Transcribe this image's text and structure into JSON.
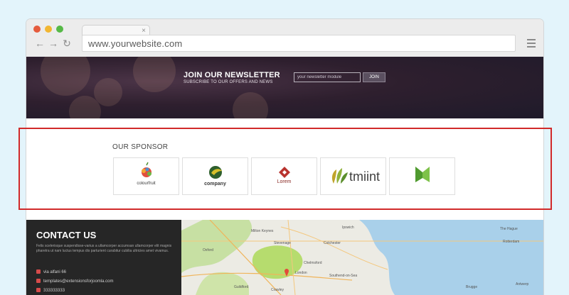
{
  "browser": {
    "url": "www.yourwebsite.com",
    "tab_close": "×"
  },
  "newsletter": {
    "title": "JOIN OUR NEWSLETTER",
    "subtitle": "SUBSCRIBE TO OUR OFFERS AND NEWS",
    "input_placeholder": "your newsletter module",
    "button_label": "JOIN"
  },
  "sponsors": {
    "title": "OUR SPONSOR",
    "items": [
      {
        "name": "colourfruit"
      },
      {
        "name": "company"
      },
      {
        "name": "Lorem"
      },
      {
        "name": "tmiint"
      },
      {
        "name": ""
      }
    ]
  },
  "contact": {
    "title": "CONTACT US",
    "description": "Felis scelerisque suspendisse-varius a ullamcorper accumsan ullamcorper elit magnis pharetra ut nam luctus tempus dis parturient curabitur cubilia ultricies amet vivamus.",
    "address": "via alfani 66",
    "email": "templates@extensionsforjoomla.com",
    "phone": "333333333"
  },
  "map": {
    "labels": [
      "Ipswich",
      "Milton Keynes",
      "Stevenage",
      "Colchester",
      "Chelmsford",
      "London",
      "Southend-on-Sea",
      "Crawley",
      "Guildford",
      "Oxford",
      "Rotterdam",
      "The Hague",
      "Antwerp",
      "Brugge"
    ]
  },
  "colors": {
    "highlight": "#d12a2a",
    "contact_bg": "#262626",
    "newsletter_bg": "#2e1f2e",
    "page_bg": "#e3f4fb"
  }
}
